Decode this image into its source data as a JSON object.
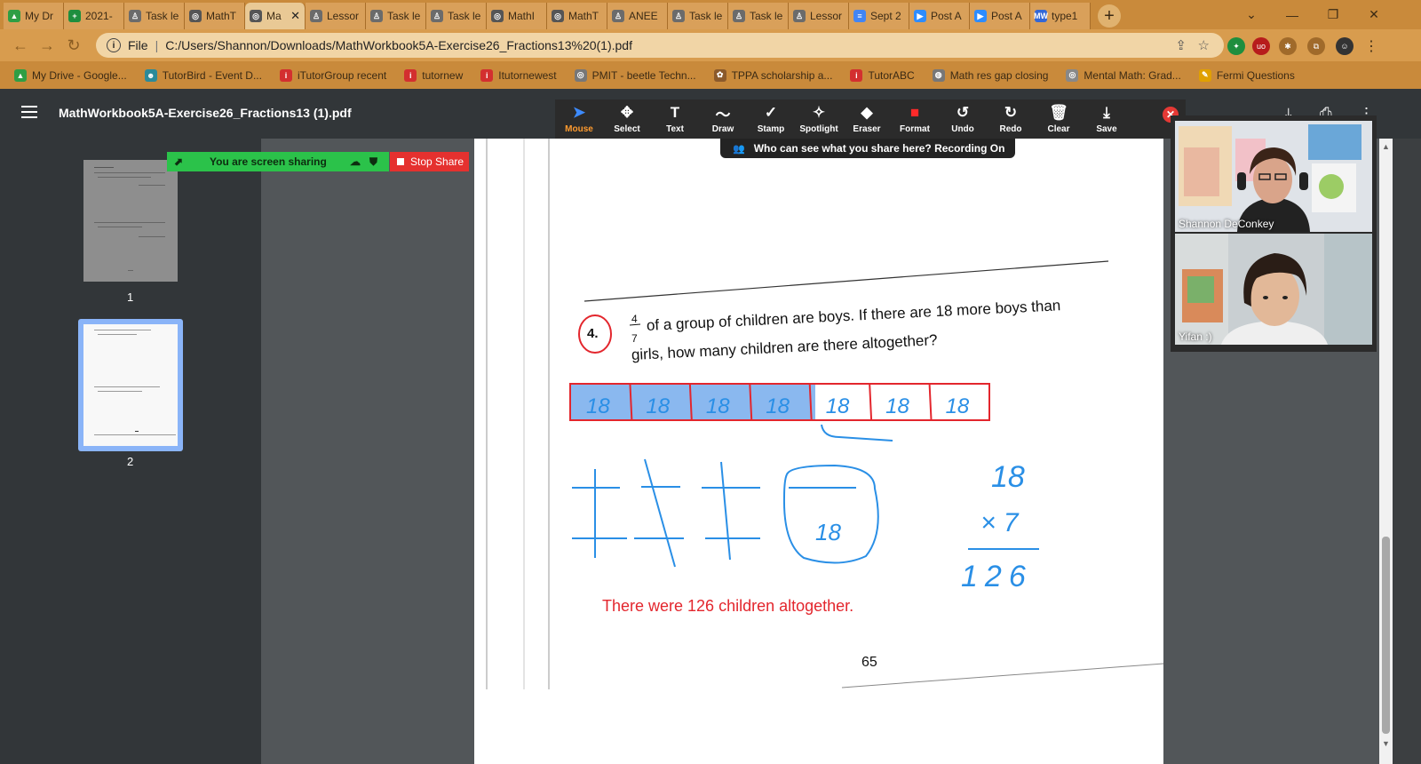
{
  "browser": {
    "tabs": [
      {
        "label": "My Dr",
        "color": "#2f9e44",
        "glyph": "▲"
      },
      {
        "label": "2021-",
        "color": "#1e8e3e",
        "glyph": "+"
      },
      {
        "label": "Task le",
        "color": "#6b6b6b",
        "glyph": "♙"
      },
      {
        "label": "MathT",
        "color": "#555555",
        "glyph": "◎"
      },
      {
        "label": "Ma",
        "color": "#555555",
        "glyph": "◎",
        "active": true
      },
      {
        "label": "Lessor",
        "color": "#6b6b6b",
        "glyph": "♙"
      },
      {
        "label": "Task le",
        "color": "#6b6b6b",
        "glyph": "♙"
      },
      {
        "label": "Task le",
        "color": "#6b6b6b",
        "glyph": "♙"
      },
      {
        "label": "MathI",
        "color": "#555555",
        "glyph": "◎"
      },
      {
        "label": "MathT",
        "color": "#555555",
        "glyph": "◎"
      },
      {
        "label": "ANEE",
        "color": "#6b6b6b",
        "glyph": "♙"
      },
      {
        "label": "Task le",
        "color": "#6b6b6b",
        "glyph": "♙"
      },
      {
        "label": "Task le",
        "color": "#6b6b6b",
        "glyph": "♙"
      },
      {
        "label": "Lessor",
        "color": "#6b6b6b",
        "glyph": "♙"
      },
      {
        "label": "Sept 2",
        "color": "#4285f4",
        "glyph": "≡"
      },
      {
        "label": "Post A",
        "color": "#2d8cff",
        "glyph": "▶"
      },
      {
        "label": "Post A",
        "color": "#2d8cff",
        "glyph": "▶"
      },
      {
        "label": "type1",
        "color": "#3367d6",
        "glyph": "MW"
      }
    ],
    "new_tab": "+",
    "address_prefix": "File",
    "url": "C:/Users/Shannon/Downloads/MathWorkbook5A-Exercise26_Fractions13%20(1).pdf",
    "bookmarks": [
      {
        "label": "My Drive - Google...",
        "color": "#2f9e44",
        "glyph": "▲"
      },
      {
        "label": "TutorBird - Event D...",
        "color": "#2b8a99",
        "glyph": "☻"
      },
      {
        "label": "iTutorGroup recent",
        "color": "#d32f2f",
        "glyph": "i"
      },
      {
        "label": "tutornew",
        "color": "#d32f2f",
        "glyph": "i"
      },
      {
        "label": "Itutornewest",
        "color": "#d32f2f",
        "glyph": "i"
      },
      {
        "label": "PMIT - beetle Techn...",
        "color": "#777777",
        "glyph": "◎"
      },
      {
        "label": "TPPA scholarship a...",
        "color": "#8b5a2b",
        "glyph": "✿"
      },
      {
        "label": "TutorABC",
        "color": "#d32f2f",
        "glyph": "i"
      },
      {
        "label": "Math res gap closing",
        "color": "#777777",
        "glyph": "◍"
      },
      {
        "label": "Mental Math: Grad...",
        "color": "#888888",
        "glyph": "◎"
      },
      {
        "label": "Fermi Questions",
        "color": "#e0a000",
        "glyph": "✎"
      }
    ]
  },
  "pdf": {
    "title": "MathWorkbook5A-Exercise26_Fractions13 (1).pdf",
    "thumbnails": [
      {
        "num": "1"
      },
      {
        "num": "2"
      }
    ],
    "page_number": "65"
  },
  "annotate": {
    "tools": [
      {
        "label": "Mouse",
        "glyph": "➤",
        "active": true
      },
      {
        "label": "Select",
        "glyph": "✥"
      },
      {
        "label": "Text",
        "glyph": "T"
      },
      {
        "label": "Draw",
        "glyph": "〜"
      },
      {
        "label": "Stamp",
        "glyph": "✓"
      },
      {
        "label": "Spotlight",
        "glyph": "✧"
      },
      {
        "label": "Eraser",
        "glyph": "◆"
      },
      {
        "label": "Format",
        "glyph": "■"
      },
      {
        "label": "Undo",
        "glyph": "↺"
      },
      {
        "label": "Redo",
        "glyph": "↻"
      },
      {
        "label": "Clear",
        "glyph": "🗑"
      },
      {
        "label": "Save",
        "glyph": "⤓"
      }
    ],
    "notice": "Who can see what you share here? Recording On"
  },
  "share": {
    "status": "You are screen sharing",
    "stop_label": "Stop Share"
  },
  "participants": [
    {
      "name": "Shannon DeConkey"
    },
    {
      "name": "Yifan :)"
    }
  ],
  "worksheet": {
    "question_number": "4.",
    "fraction_num": "4",
    "fraction_den": "7",
    "line1": "of a group of children are boys. If there are 18 more boys than",
    "line2": "girls, how many children are there altogether?",
    "bar_units": [
      "18",
      "18",
      "18",
      "18",
      "18",
      "18",
      "18"
    ],
    "work_top": "18",
    "work_mult": "× 7",
    "work_result": "126",
    "boxed_value": "18",
    "answer": "There were 126 children altogether."
  },
  "colors": {
    "accent_orange": "#ff9b2f",
    "zoom_blue": "#2d8cff",
    "ink_blue": "#2a8fe6",
    "answer_red": "#e3262d",
    "share_green": "#2bc24a"
  }
}
